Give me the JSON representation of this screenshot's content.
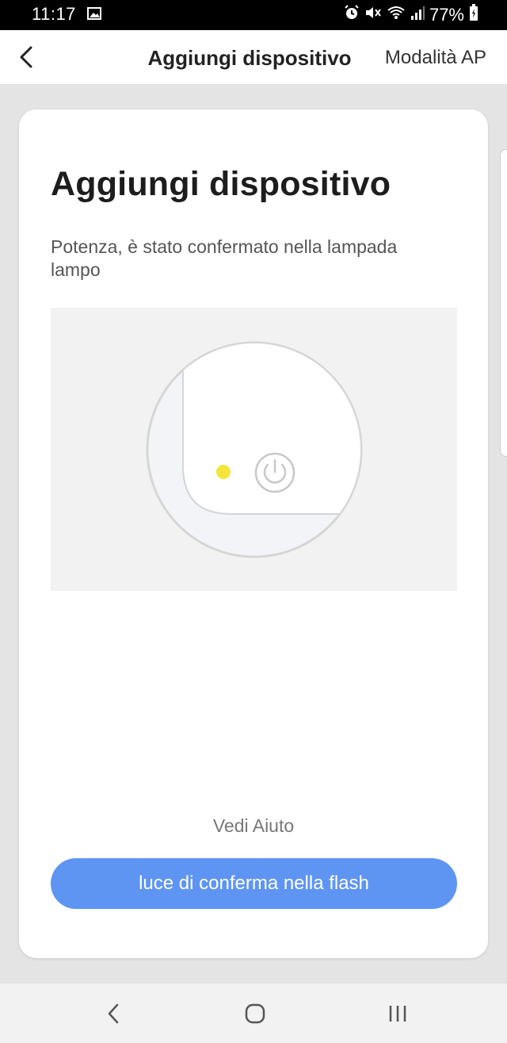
{
  "status_bar": {
    "time": "11:17",
    "battery_percent": "77%",
    "icons": [
      "image-icon",
      "alarm-icon",
      "mute-icon",
      "wifi-icon",
      "signal-icon",
      "battery-charging-icon"
    ]
  },
  "app_bar": {
    "title": "Aggiungi dispositivo",
    "action": "Modalità AP",
    "back_icon": "chevron-left-icon"
  },
  "card": {
    "title": "Aggiungi dispositivo",
    "description": "Potenza, è stato confermato nella lampada lampo",
    "illustration": {
      "led_color": "#f5e53a",
      "icon": "power-icon"
    },
    "help_link": "Vedi Aiuto",
    "primary_button": "luce di conferma nella flash"
  },
  "nav_bar": {
    "items": [
      "back-icon",
      "home-icon",
      "recents-icon"
    ]
  },
  "colors": {
    "accent": "#5f95f2",
    "background": "#e4e4e4"
  }
}
